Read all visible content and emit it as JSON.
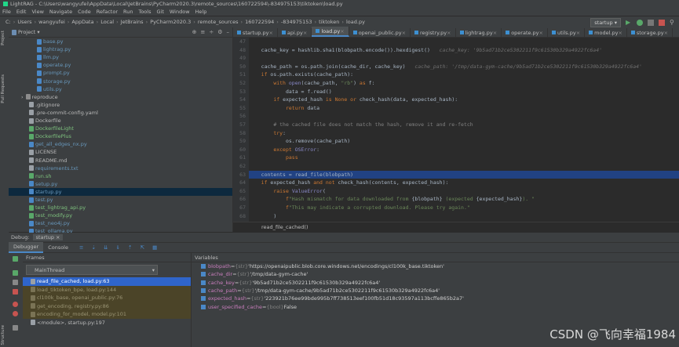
{
  "window": {
    "title": "LightRAG - C:\\Users\\wangyufei\\AppData\\Local\\JetBrains\\PyCharm2020.3\\remote_sources\\160722594\\-834975153\\tiktoken\\load.py"
  },
  "menu": [
    "File",
    "Edit",
    "View",
    "Navigate",
    "Code",
    "Refactor",
    "Run",
    "Tools",
    "Git",
    "Window",
    "Help"
  ],
  "breadcrumbs": [
    "C:",
    "Users",
    "wangyufei",
    "AppData",
    "Local",
    "JetBrains",
    "PyCharm2020.3",
    "remote_sources",
    "160722594",
    "-834975153",
    "tiktoken",
    "load.py"
  ],
  "run_config": "startup",
  "left_tools": [
    "Project",
    "Pull Requests",
    "Structure"
  ],
  "project": {
    "title": "Project",
    "items": [
      {
        "name": "base.py",
        "indent": 3,
        "kind": "py"
      },
      {
        "name": "lightrag.py",
        "indent": 3,
        "kind": "py"
      },
      {
        "name": "llm.py",
        "indent": 3,
        "kind": "py"
      },
      {
        "name": "operate.py",
        "indent": 3,
        "kind": "py"
      },
      {
        "name": "prompt.py",
        "indent": 3,
        "kind": "py"
      },
      {
        "name": "storage.py",
        "indent": 3,
        "kind": "py"
      },
      {
        "name": "utils.py",
        "indent": 3,
        "kind": "py"
      },
      {
        "name": "reproduce",
        "indent": 1,
        "kind": "folder"
      },
      {
        "name": ".gitignore",
        "indent": 2,
        "kind": "file"
      },
      {
        "name": ".pre-commit-config.yaml",
        "indent": 2,
        "kind": "file"
      },
      {
        "name": "Dockerfile",
        "indent": 2,
        "kind": "file"
      },
      {
        "name": "DockerfileLight",
        "indent": 2,
        "kind": "filegreen"
      },
      {
        "name": "DockerfilePlus",
        "indent": 2,
        "kind": "filegreen"
      },
      {
        "name": "get_all_edges_nx.py",
        "indent": 2,
        "kind": "py"
      },
      {
        "name": "LICENSE",
        "indent": 2,
        "kind": "file"
      },
      {
        "name": "README.md",
        "indent": 2,
        "kind": "file"
      },
      {
        "name": "requirements.txt",
        "indent": 2,
        "kind": "txt"
      },
      {
        "name": "run.sh",
        "indent": 2,
        "kind": "filegreen"
      },
      {
        "name": "setup.py",
        "indent": 2,
        "kind": "py"
      },
      {
        "name": "startup.py",
        "indent": 2,
        "kind": "pysel"
      },
      {
        "name": "test.py",
        "indent": 2,
        "kind": "py"
      },
      {
        "name": "test_lightrag_api.py",
        "indent": 2,
        "kind": "pygreen"
      },
      {
        "name": "test_modify.py",
        "indent": 2,
        "kind": "pygreen"
      },
      {
        "name": "test_neo4j.py",
        "indent": 2,
        "kind": "py"
      },
      {
        "name": "test_ollama.py",
        "indent": 2,
        "kind": "py"
      }
    ]
  },
  "editor": {
    "tabs": [
      "startup.py",
      "api.py",
      "load.py",
      "openai_public.py",
      "registry.py",
      "lightrag.py",
      "operate.py",
      "utils.py",
      "model.py",
      "storage.py"
    ],
    "active_tab": 2,
    "lines": [
      {
        "n": "47",
        "html": ""
      },
      {
        "n": "48",
        "html": "    <span class='txt'>cache_key = hashlib.sha1(blobpath.encode()).hexdigest()</span>   <span class='hint'>cache_key: '9b5ad71b2ce5302211f9c61530b329a4922fc6a4'</span>"
      },
      {
        "n": "49",
        "html": ""
      },
      {
        "n": "50",
        "html": "    <span class='txt'>cache_path = os.path.join(cache_dir, cache_key)</span>   <span class='hint'>cache_path: '/tmp/data-gym-cache/9b5ad71b2ce5302211f9c61530b329a4922fc6a4'</span>"
      },
      {
        "n": "51",
        "html": "    <span class='kw'>if</span> <span class='txt'>os.path.exists(cache_path):</span>"
      },
      {
        "n": "52",
        "html": "        <span class='kw'>with</span> <span class='bi'>open</span><span class='txt'>(cache_path, </span><span class='str'>\"rb\"</span><span class='txt'>) </span><span class='kw'>as</span> <span class='txt'>f:</span>"
      },
      {
        "n": "53",
        "html": "            <span class='txt'>data = f.read()</span>"
      },
      {
        "n": "54",
        "html": "        <span class='kw'>if</span> <span class='txt'>expected_hash </span><span class='kw'>is None or</span> <span class='txt'>check_hash(data, expected_hash):</span>"
      },
      {
        "n": "55",
        "html": "            <span class='kw'>return</span> <span class='txt'>data</span>"
      },
      {
        "n": "56",
        "html": ""
      },
      {
        "n": "57",
        "html": "        <span class='cm'># the cached file does not match the hash, remove it and re-fetch</span>"
      },
      {
        "n": "58",
        "html": "        <span class='kw'>try</span><span class='txt'>:</span>"
      },
      {
        "n": "59",
        "html": "            <span class='txt'>os.remove(cache_path)</span>"
      },
      {
        "n": "60",
        "html": "        <span class='kw'>except</span> <span class='bi'>OSError</span><span class='txt'>:</span>"
      },
      {
        "n": "61",
        "html": "            <span class='kw'>pass</span>"
      },
      {
        "n": "62",
        "html": ""
      },
      {
        "n": "63",
        "html": "    <span class='txt'>contents = read_file(blobpath)</span>",
        "current": true
      },
      {
        "n": "64",
        "html": "    <span class='kw'>if</span> <span class='txt'>expected_hash </span><span class='kw'>and not</span> <span class='txt'>check_hash(contents, expected_hash):</span>"
      },
      {
        "n": "65",
        "html": "        <span class='kw'>raise</span> <span class='bi'>ValueError</span><span class='txt'>(</span>"
      },
      {
        "n": "66",
        "html": "            <span class='kw'>f</span><span class='str'>\"Hash mismatch for data downloaded from </span><span class='txt'>{blobpath}</span><span class='str'> (expected </span><span class='txt'>{expected_hash}</span><span class='str'>). \"</span>"
      },
      {
        "n": "67",
        "html": "            <span class='kw'>f</span><span class='str'>\"This may indicate a corrupted download. Please try again.\"</span>"
      },
      {
        "n": "68",
        "html": "        <span class='txt'>)</span>"
      }
    ],
    "breadcrumb_fn": "read_file_cached()"
  },
  "debug": {
    "label": "Debug:",
    "config": "startup",
    "tabs": [
      "Debugger",
      "Console"
    ],
    "frames_label": "Frames",
    "variables_label": "Variables",
    "thread": "MainThread",
    "frames": [
      {
        "text": "read_file_cached, load.py:63",
        "state": "sel"
      },
      {
        "text": "load_tiktoken_bpe, load.py:144",
        "state": "lib"
      },
      {
        "text": "cl100k_base, openai_public.py:76",
        "state": "lib"
      },
      {
        "text": "get_encoding, registry.py:86",
        "state": "lib"
      },
      {
        "text": "encoding_for_model, model.py:101",
        "state": "lib"
      },
      {
        "text": "<module>, startup.py:197",
        "state": ""
      }
    ],
    "variables": [
      {
        "name": "blobpath",
        "type": "{str}",
        "value": "'https://openaipublic.blob.core.windows.net/encodings/cl100k_base.tiktoken'"
      },
      {
        "name": "cache_dir",
        "type": "{str}",
        "value": "'/tmp/data-gym-cache'"
      },
      {
        "name": "cache_key",
        "type": "{str}",
        "value": "'9b5ad71b2ce5302211f9c61530b329a4922fc6a4'"
      },
      {
        "name": "cache_path",
        "type": "{str}",
        "value": "'/tmp/data-gym-cache/9b5ad71b2ce5302211f9c61530b329a4922fc6a4'"
      },
      {
        "name": "expected_hash",
        "type": "{str}",
        "value": "'223921b76ee99bde995b7ff738513eef100fb51d18c93597a113bcffe865b2a7'"
      },
      {
        "name": "user_specified_cache",
        "type": "{bool}",
        "value": "False"
      }
    ]
  },
  "watermark": "CSDN @飞向幸福1984",
  "colors": {
    "accent": "#4a88c7",
    "selection": "#2f65ca",
    "current_line": "#214283"
  }
}
